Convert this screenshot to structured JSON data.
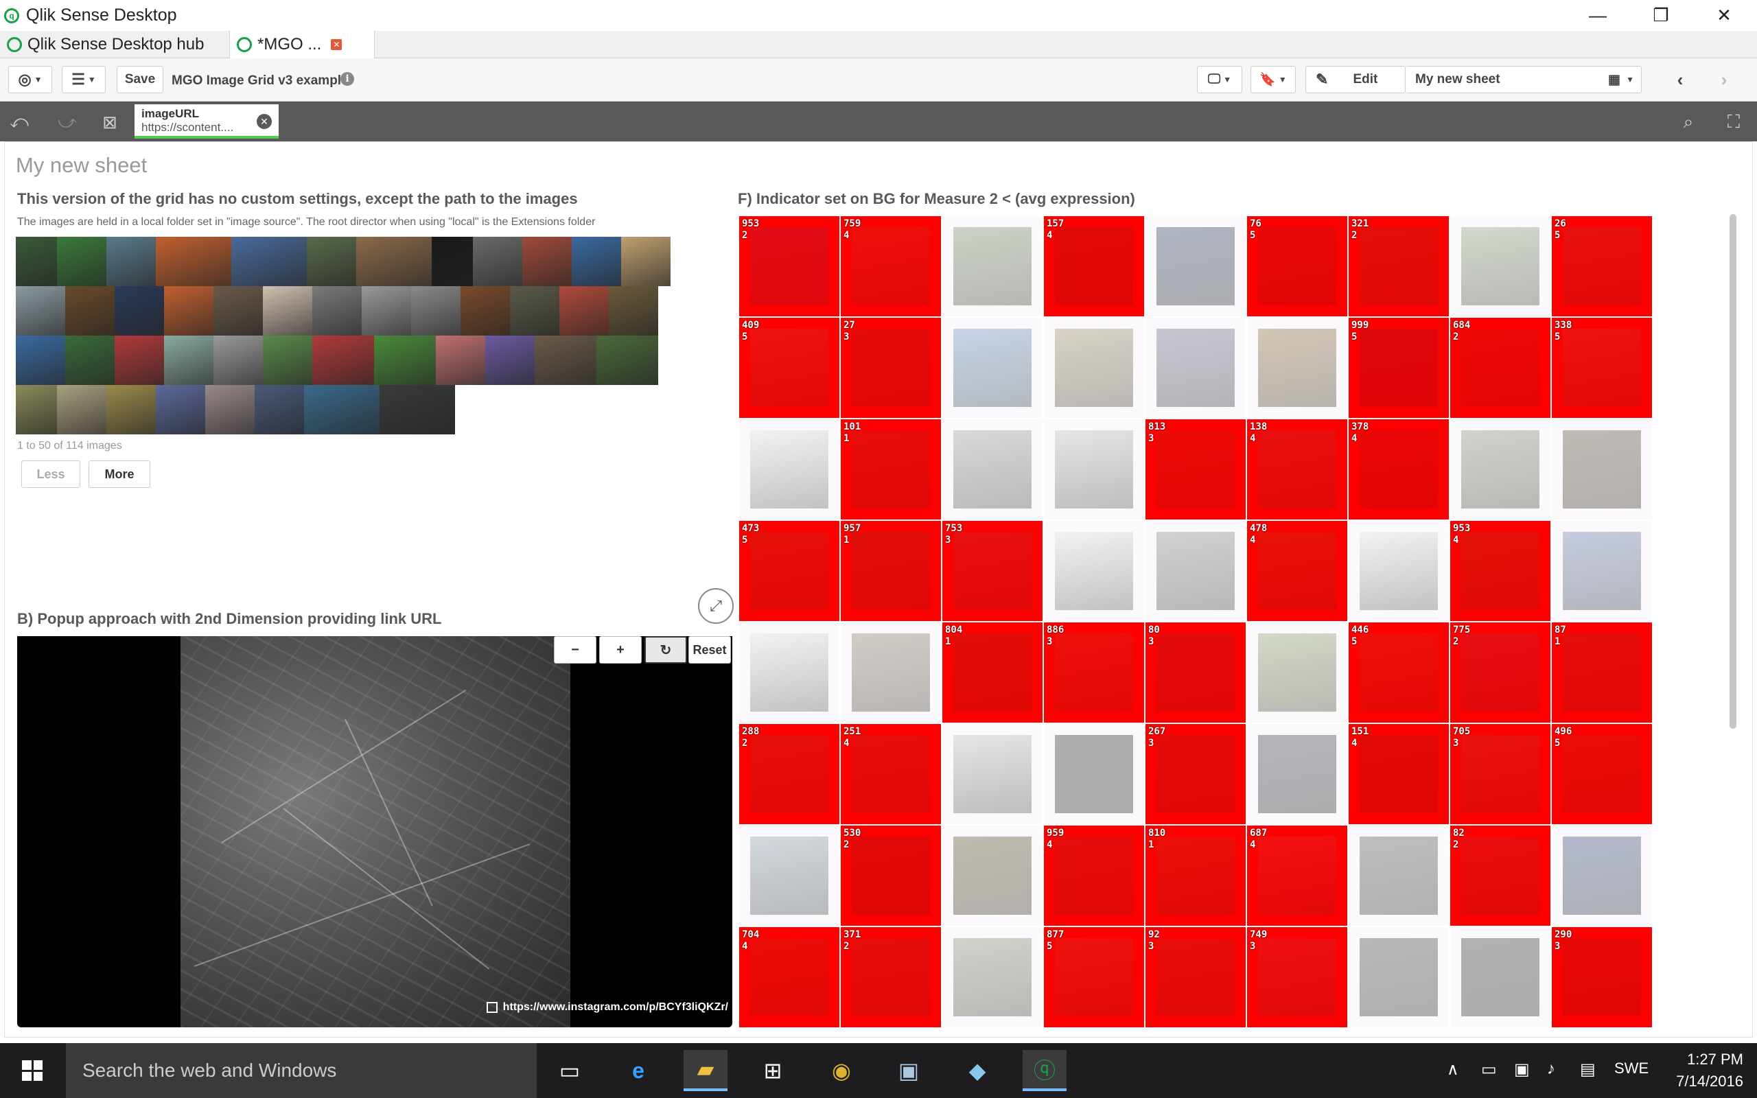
{
  "window": {
    "title": "Qlik Sense Desktop",
    "controls": [
      "—",
      "❐",
      "✕"
    ]
  },
  "tabs": [
    {
      "label": "Qlik Sense Desktop hub"
    },
    {
      "label": "*MGO ...",
      "close": "✕"
    }
  ],
  "toolbar": {
    "save_label": "Save",
    "app_name": "MGO Image Grid v3 example",
    "info_icon": "i",
    "edit_label": "Edit",
    "sheet_name": "My new sheet"
  },
  "selections": {
    "field": "imageURL",
    "value": "https://scontent....",
    "clear": "✕"
  },
  "sheet": {
    "title": "My new sheet",
    "grid1": {
      "title": "This version of the grid has no custom settings, except the path to the images",
      "subtitle": "The images are held in a local folder set in \"image source\". The root director when using \"local\" is the Extensions folder",
      "pager": "1 to 50 of 114 images",
      "less_label": "Less",
      "more_label": "More"
    },
    "popup": {
      "title": "B) Popup approach with 2nd Dimension providing link URL",
      "zoom_out": "−",
      "zoom_in": "+",
      "rotate": "↻",
      "reset_label": "Reset",
      "link": "https://www.instagram.com/p/BCYf3liQKZr/"
    },
    "indicator": {
      "title": "F) Indicator set on BG for Measure 2 < (avg expression)",
      "cells": [
        {
          "n": "953",
          "m": "2",
          "red": true,
          "c": "#3a5a9a"
        },
        {
          "n": "759",
          "m": "4",
          "red": true,
          "c": "#8a6a4a"
        },
        {
          "n": "",
          "m": "",
          "red": false,
          "c": "#7a8a6a"
        },
        {
          "n": "157",
          "m": "4",
          "red": true,
          "c": "#3a3a3a"
        },
        {
          "n": "",
          "m": "",
          "red": false,
          "c": "#2a3a5a"
        },
        {
          "n": "76",
          "m": "5",
          "red": true,
          "c": "#5a3a2a"
        },
        {
          "n": "321",
          "m": "2",
          "red": true,
          "c": "#4a6a3a"
        },
        {
          "n": "",
          "m": "",
          "red": false,
          "c": "#8a9a7a"
        },
        {
          "n": "26",
          "m": "5",
          "red": true,
          "c": "#6a6a6a"
        },
        {
          "n": "409",
          "m": "5",
          "red": true,
          "c": "#8a7a6a"
        },
        {
          "n": "27",
          "m": "3",
          "red": true,
          "c": "#4a4a4a"
        },
        {
          "n": "",
          "m": "",
          "red": false,
          "c": "#6a90c0"
        },
        {
          "n": "",
          "m": "",
          "red": false,
          "c": "#9a8a6a"
        },
        {
          "n": "",
          "m": "",
          "red": false,
          "c": "#6a6a8a"
        },
        {
          "n": "",
          "m": "",
          "red": false,
          "c": "#8a6a3a"
        },
        {
          "n": "999",
          "m": "5",
          "red": true,
          "c": "#1a2a5a"
        },
        {
          "n": "684",
          "m": "2",
          "red": true,
          "c": "#8a3a2a"
        },
        {
          "n": "338",
          "m": "5",
          "red": true,
          "c": "#8a7a6a"
        },
        {
          "n": "",
          "m": "",
          "red": false,
          "c": "#ddd"
        },
        {
          "n": "101",
          "m": "1",
          "red": true,
          "c": "#6a5a4a"
        },
        {
          "n": "",
          "m": "",
          "red": false,
          "c": "#9a9a9a"
        },
        {
          "n": "",
          "m": "",
          "red": false,
          "c": "#bbb"
        },
        {
          "n": "813",
          "m": "3",
          "red": true,
          "c": "#8a4a2a"
        },
        {
          "n": "138",
          "m": "4",
          "red": true,
          "c": "#6a6a6a"
        },
        {
          "n": "378",
          "m": "4",
          "red": true,
          "c": "#7a2a2a"
        },
        {
          "n": "",
          "m": "",
          "red": false,
          "c": "#8a8a7a"
        },
        {
          "n": "",
          "m": "",
          "red": false,
          "c": "#5a4a3a"
        },
        {
          "n": "473",
          "m": "5",
          "red": true,
          "c": "#5a6a3a"
        },
        {
          "n": "957",
          "m": "1",
          "red": true,
          "c": "#3a6a4a"
        },
        {
          "n": "753",
          "m": "3",
          "red": true,
          "c": "#6a6a7a"
        },
        {
          "n": "",
          "m": "",
          "red": false,
          "c": "#ddd"
        },
        {
          "n": "",
          "m": "",
          "red": false,
          "c": "#888"
        },
        {
          "n": "478",
          "m": "4",
          "red": true,
          "c": "#6a7a3a"
        },
        {
          "n": "",
          "m": "",
          "red": false,
          "c": "#ddd"
        },
        {
          "n": "953",
          "m": "4",
          "red": true,
          "c": "#4a7a3a"
        },
        {
          "n": "",
          "m": "",
          "red": false,
          "c": "#6a7aaa"
        },
        {
          "n": "",
          "m": "",
          "red": false,
          "c": "#ddd"
        },
        {
          "n": "",
          "m": "",
          "red": false,
          "c": "#8a7a6a"
        },
        {
          "n": "804",
          "m": "1",
          "red": true,
          "c": "#3a5a2a"
        },
        {
          "n": "886",
          "m": "3",
          "red": true,
          "c": "#8a6a4a"
        },
        {
          "n": "80",
          "m": "3",
          "red": true,
          "c": "#4a4a5a"
        },
        {
          "n": "",
          "m": "",
          "red": false,
          "c": "#8a9a6a"
        },
        {
          "n": "446",
          "m": "5",
          "red": true,
          "c": "#9a6a3a"
        },
        {
          "n": "775",
          "m": "2",
          "red": true,
          "c": "#6a5a8a"
        },
        {
          "n": "87",
          "m": "1",
          "red": true,
          "c": "#5a5a5a"
        },
        {
          "n": "288",
          "m": "2",
          "red": true,
          "c": "#5a6a4a"
        },
        {
          "n": "251",
          "m": "4",
          "red": true,
          "c": "#6a5a4a"
        },
        {
          "n": "",
          "m": "",
          "red": false,
          "c": "#bbb"
        },
        {
          "n": "",
          "m": "",
          "red": false,
          "c": "#2a2a2a"
        },
        {
          "n": "267",
          "m": "3",
          "red": true,
          "c": "#4a4a4a"
        },
        {
          "n": "",
          "m": "",
          "red": false,
          "c": "#3a3a4a"
        },
        {
          "n": "151",
          "m": "4",
          "red": true,
          "c": "#3a3a3a"
        },
        {
          "n": "705",
          "m": "3",
          "red": true,
          "c": "#6a7a6a"
        },
        {
          "n": "496",
          "m": "5",
          "red": true,
          "c": "#7a5a2a"
        },
        {
          "n": "",
          "m": "",
          "red": false,
          "c": "#8a9aaa"
        },
        {
          "n": "530",
          "m": "2",
          "red": true,
          "c": "#3a3a3a"
        },
        {
          "n": "",
          "m": "",
          "red": false,
          "c": "#5a4a2a"
        },
        {
          "n": "959",
          "m": "4",
          "red": true,
          "c": "#5a5a5a"
        },
        {
          "n": "810",
          "m": "1",
          "red": true,
          "c": "#7a6a3a"
        },
        {
          "n": "687",
          "m": "4",
          "red": true,
          "c": "#aa6a7a"
        },
        {
          "n": "",
          "m": "",
          "red": false,
          "c": "#555"
        },
        {
          "n": "82",
          "m": "2",
          "red": true,
          "c": "#7a5a5a"
        },
        {
          "n": "",
          "m": "",
          "red": false,
          "c": "#3a4a7a"
        },
        {
          "n": "704",
          "m": "4",
          "red": true,
          "c": "#7a5a2a"
        },
        {
          "n": "371",
          "m": "2",
          "red": true,
          "c": "#5a5a5a"
        },
        {
          "n": "",
          "m": "",
          "red": false,
          "c": "#8a8a7a"
        },
        {
          "n": "877",
          "m": "5",
          "red": true,
          "c": "#8a7a5a"
        },
        {
          "n": "92",
          "m": "3",
          "red": true,
          "c": "#6a5a4a"
        },
        {
          "n": "749",
          "m": "3",
          "red": true,
          "c": "#8a6a7a"
        },
        {
          "n": "",
          "m": "",
          "red": false,
          "c": "#444"
        },
        {
          "n": "",
          "m": "",
          "red": false,
          "c": "#333"
        },
        {
          "n": "290",
          "m": "3",
          "red": true,
          "c": "#5a3a2a"
        }
      ]
    }
  },
  "mosaic_colors": [
    "#3a5a3a",
    "#3a7a3a",
    "#5a7a8a",
    "#c06030",
    "#4a6a9a",
    "#5a6a4a",
    "#8a6a4a",
    "#1a1a1a",
    "#6a6a6a",
    "#a04a3a",
    "#3a6aa0",
    "#c0a070",
    "#8a9aa0",
    "#6a4a2a",
    "#2a3a5a",
    "#c06030",
    "#6a5a4a",
    "#d0c0b0",
    "#7a7a7a",
    "#9a9a9a",
    "#8a8a8a",
    "#7a4a2a",
    "#5a5a4a",
    "#b04a3a",
    "#6a5a3a",
    "#3a6aa0",
    "#3a6a3a",
    "#b03a3a",
    "#8aaaa0",
    "#9a9a9a",
    "#5a8a4a",
    "#b03a3a",
    "#4a8a3a",
    "#c07070",
    "#6a5aa0",
    "#6a5a4a",
    "#4a6a3a",
    "#8a8a5a",
    "#aaa080",
    "#9a8a4a",
    "#5a6a9a",
    "#9a8a8a",
    "#4a5a7a",
    "#3a6a8a",
    "#3a3a3a",
    "#5a4a2a"
  ],
  "taskbar": {
    "search_placeholder": "Search the web and Windows",
    "language": "SWE",
    "time": "1:27 PM",
    "date": "7/14/2016"
  }
}
